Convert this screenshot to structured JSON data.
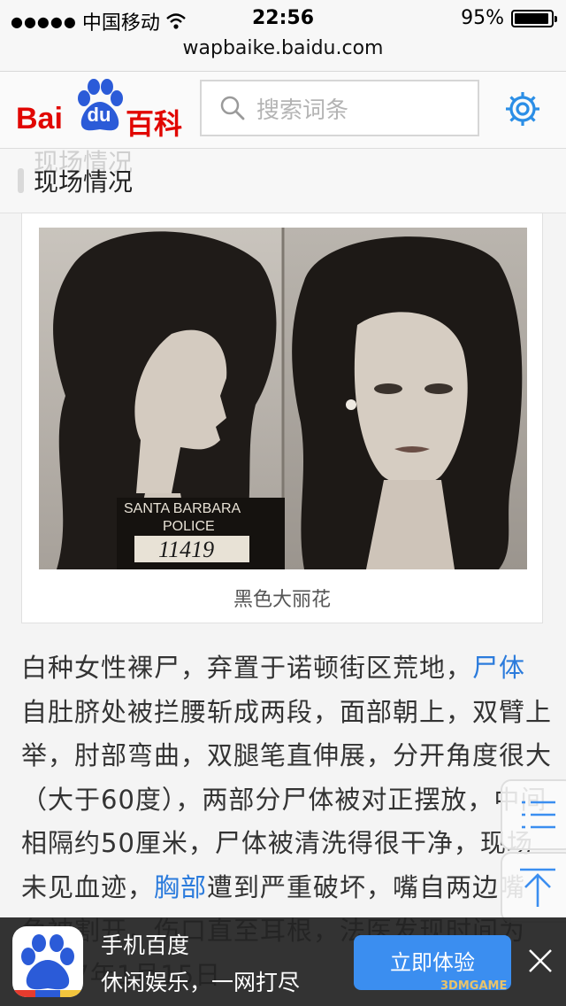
{
  "status_bar": {
    "carrier": "中国移动",
    "time": "22:56",
    "battery": "95%",
    "battery_level": 0.95
  },
  "url": "wapbaike.baidu.com",
  "header": {
    "logo_bai": "Bai",
    "logo_du": "du",
    "logo_baike": "百科",
    "search_placeholder": "搜索词条"
  },
  "section": {
    "title": "现场情况"
  },
  "figure": {
    "plate_line1": "SANTA BARBARA",
    "plate_line2": "POLICE",
    "plate_number": "11419",
    "caption": "黑色大丽花"
  },
  "article": {
    "p1_a": "白种女性裸尸，弃置于诺顿街区荒地，",
    "link1": "尸体",
    "p1_b": "自肚脐处被拦腰斩成两段，面部朝上，双臂上举，肘部弯曲，双腿笔直伸展，分开角度很大（大于60度），两部分尸体被对正摆放，中间相隔约50厘米，尸体被清洗得很干净，现场未见血迹，",
    "link2": "胸部",
    "p1_c": "遭到严重破坏，嘴自两边嘴角被割开，伤口直至耳根，法医发现时间为1947年1月15日"
  },
  "banner": {
    "title": "手机百度",
    "subtitle": "休闲娱乐，一网打尽",
    "button": "立即体验"
  },
  "watermark": "3DMGAME",
  "icons": [
    "signal-dots-icon",
    "wifi-icon",
    "battery-icon",
    "baidu-paw-icon",
    "search-icon",
    "gear-icon",
    "list-icon",
    "back-to-top-icon",
    "close-icon"
  ],
  "colors": {
    "brand_red": "#e10601",
    "brand_blue": "#2b5bd8",
    "link": "#2b7bdc",
    "cta": "#3b8ef0"
  }
}
